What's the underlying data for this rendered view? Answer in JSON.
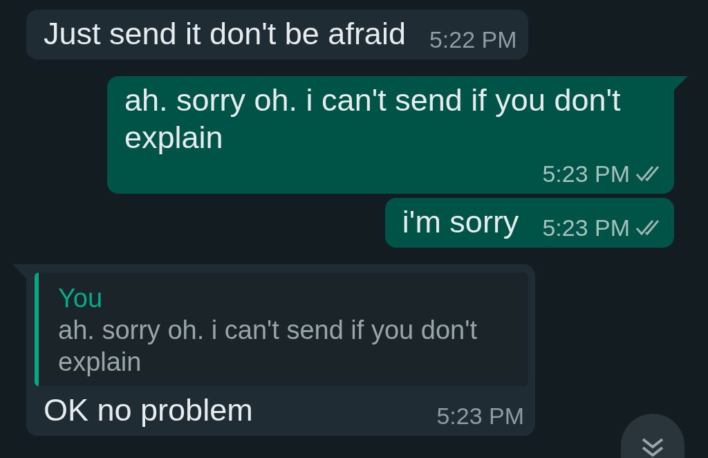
{
  "messages": [
    {
      "kind": "incoming",
      "text": "Just send it don't be afraid",
      "time": "5:22 PM",
      "tail": false
    },
    {
      "kind": "outgoing",
      "text": "ah. sorry oh. i can't send if you don't explain",
      "time": "5:23 PM",
      "tail": true,
      "read": false
    },
    {
      "kind": "outgoing",
      "text": "i'm sorry",
      "time": "5:23 PM",
      "tail": false,
      "read": false
    },
    {
      "kind": "incoming",
      "text": "OK no problem",
      "time": "5:23 PM",
      "tail": true,
      "quote": {
        "author": "You",
        "text": "ah. sorry oh. i can't send if you don't explain"
      }
    }
  ]
}
